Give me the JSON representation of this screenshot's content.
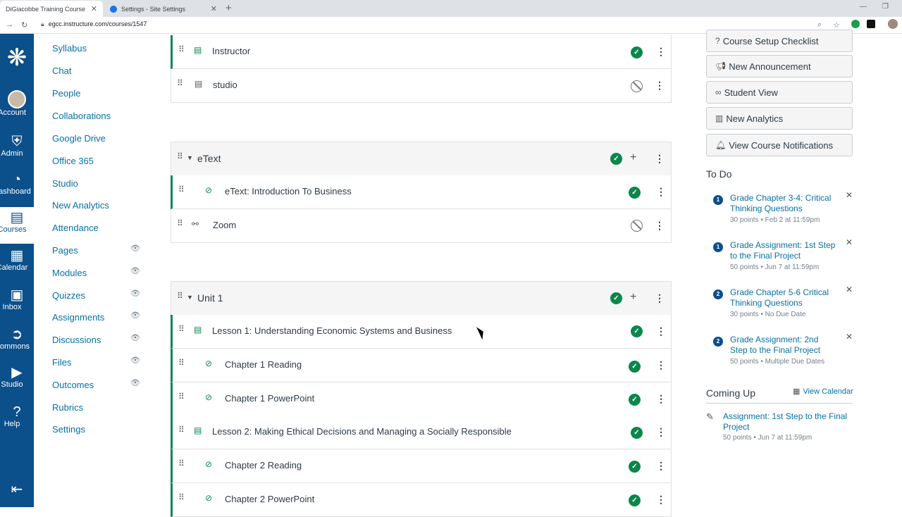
{
  "browser": {
    "tabs": [
      {
        "title": "DiGiacobbe Training Course"
      },
      {
        "title": "Settings - Site Settings"
      }
    ],
    "url": "egcc.instructure.com/courses/1547"
  },
  "global_nav": [
    {
      "label": "Account",
      "icon": "avatar"
    },
    {
      "label": "Admin",
      "icon": "shield-icon"
    },
    {
      "label": "Dashboard",
      "icon": "dashboard-icon"
    },
    {
      "label": "Courses",
      "icon": "book-icon"
    },
    {
      "label": "Calendar",
      "icon": "calendar-icon"
    },
    {
      "label": "Inbox",
      "icon": "inbox-icon"
    },
    {
      "label": "Commons",
      "icon": "commons-icon"
    },
    {
      "label": "Studio",
      "icon": "studio-icon"
    },
    {
      "label": "Help",
      "icon": "help-icon"
    }
  ],
  "course_nav": [
    {
      "label": "Syllabus",
      "hidden": false
    },
    {
      "label": "Chat",
      "hidden": false
    },
    {
      "label": "People",
      "hidden": false
    },
    {
      "label": "Collaborations",
      "hidden": false
    },
    {
      "label": "Google Drive",
      "hidden": false
    },
    {
      "label": "Office 365",
      "hidden": false
    },
    {
      "label": "Studio",
      "hidden": false
    },
    {
      "label": "New Analytics",
      "hidden": false
    },
    {
      "label": "Attendance",
      "hidden": false
    },
    {
      "label": "Pages",
      "hidden": true
    },
    {
      "label": "Modules",
      "hidden": true
    },
    {
      "label": "Quizzes",
      "hidden": true
    },
    {
      "label": "Assignments",
      "hidden": true
    },
    {
      "label": "Discussions",
      "hidden": true
    },
    {
      "label": "Files",
      "hidden": true
    },
    {
      "label": "Outcomes",
      "hidden": true
    },
    {
      "label": "Rubrics",
      "hidden": false
    },
    {
      "label": "Settings",
      "hidden": false
    }
  ],
  "modules": {
    "top_items": [
      {
        "title": "Instructor",
        "type": "page",
        "published": true
      },
      {
        "title": "studio",
        "type": "page",
        "published": false
      }
    ],
    "etext": {
      "title": "eText",
      "items": [
        {
          "title": "eText: Introduction To Business",
          "type": "attachment",
          "published": true
        },
        {
          "title": "Zoom",
          "type": "link",
          "published": false
        }
      ]
    },
    "unit1": {
      "title": "Unit 1",
      "items": [
        {
          "title": "Lesson 1: Understanding Economic Systems and Business",
          "type": "page",
          "published": true
        },
        {
          "title": "Chapter 1 Reading",
          "type": "attachment",
          "published": true
        },
        {
          "title": "Chapter 1 PowerPoint",
          "type": "attachment",
          "published": true
        },
        {
          "title": "Lesson 2: Making Ethical Decisions and Managing a Socially Responsible",
          "type": "page",
          "published": true
        },
        {
          "title": "Chapter 2 Reading",
          "type": "attachment",
          "published": true
        },
        {
          "title": "Chapter 2 PowerPoint",
          "type": "attachment",
          "published": true
        }
      ]
    }
  },
  "sidebar": {
    "buttons": [
      {
        "label": "Course Setup Checklist",
        "icon": "help-circle-icon"
      },
      {
        "label": "New Announcement",
        "icon": "megaphone-icon"
      },
      {
        "label": "Student View",
        "icon": "glasses-icon"
      },
      {
        "label": "New Analytics",
        "icon": "analytics-icon"
      },
      {
        "label": "View Course Notifications",
        "icon": "bell-icon"
      }
    ],
    "todo_title": "To Do",
    "todo": [
      {
        "count": "1",
        "title": "Grade Chapter 3-4: Critical Thinking Questions",
        "meta": "30 points • Feb 2 at 11:59pm"
      },
      {
        "count": "1",
        "title": "Grade Assignment: 1st Step to the Final Project",
        "meta": "50 points • Jun 7 at 11:59pm"
      },
      {
        "count": "2",
        "title": "Grade Chapter 5-6 Critical Thinking Questions",
        "meta": "30 points • No Due Date"
      },
      {
        "count": "2",
        "title": "Grade Assignment: 2nd Step to the Final Project",
        "meta": "50 points • Multiple Due Dates"
      }
    ],
    "coming_up_title": "Coming Up",
    "view_calendar": "View Calendar",
    "coming_up": [
      {
        "title": "Assignment: 1st Step to the Final Project",
        "meta": "50 points • Jun 7 at 11:59pm"
      }
    ]
  }
}
